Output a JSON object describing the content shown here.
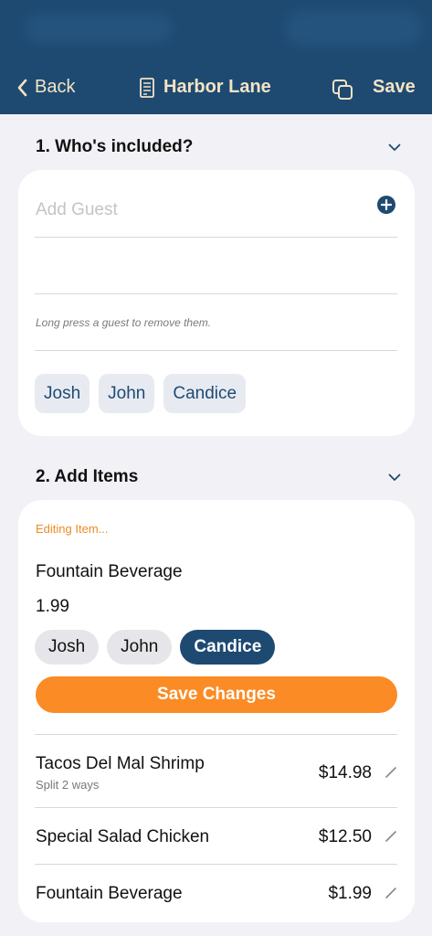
{
  "header": {
    "back_label": "Back",
    "title": "Harbor Lane",
    "save_label": "Save"
  },
  "section1": {
    "title": "1. Who's included?",
    "placeholder": "Add Guest",
    "hint": "Long press a guest to remove them.",
    "guests": [
      "Josh",
      "John",
      "Candice"
    ]
  },
  "section2": {
    "title": "2. Add Items",
    "editing_label": "Editing Item...",
    "item_name": "Fountain Beverage",
    "item_price": "1.99",
    "assignees": [
      "Josh",
      "John",
      "Candice"
    ],
    "selected_assignee": "Candice",
    "save_changes_label": "Save Changes",
    "items": [
      {
        "name": "Tacos Del Mal Shrimp",
        "sub": "Split 2 ways",
        "price": "$14.98"
      },
      {
        "name": "Special Salad Chicken",
        "sub": "",
        "price": "$12.50"
      },
      {
        "name": "Fountain Beverage",
        "sub": "",
        "price": "$1.99"
      }
    ]
  },
  "colors": {
    "header_bg": "#1e4a72",
    "header_text": "#f3e3c4",
    "accent_orange": "#fb8b24",
    "chip_selected": "#1e4a72"
  },
  "icons": [
    "chevron-left-icon",
    "receipt-icon",
    "copy-icon",
    "chevron-down-icon",
    "plus-circle-icon",
    "pencil-icon"
  ]
}
